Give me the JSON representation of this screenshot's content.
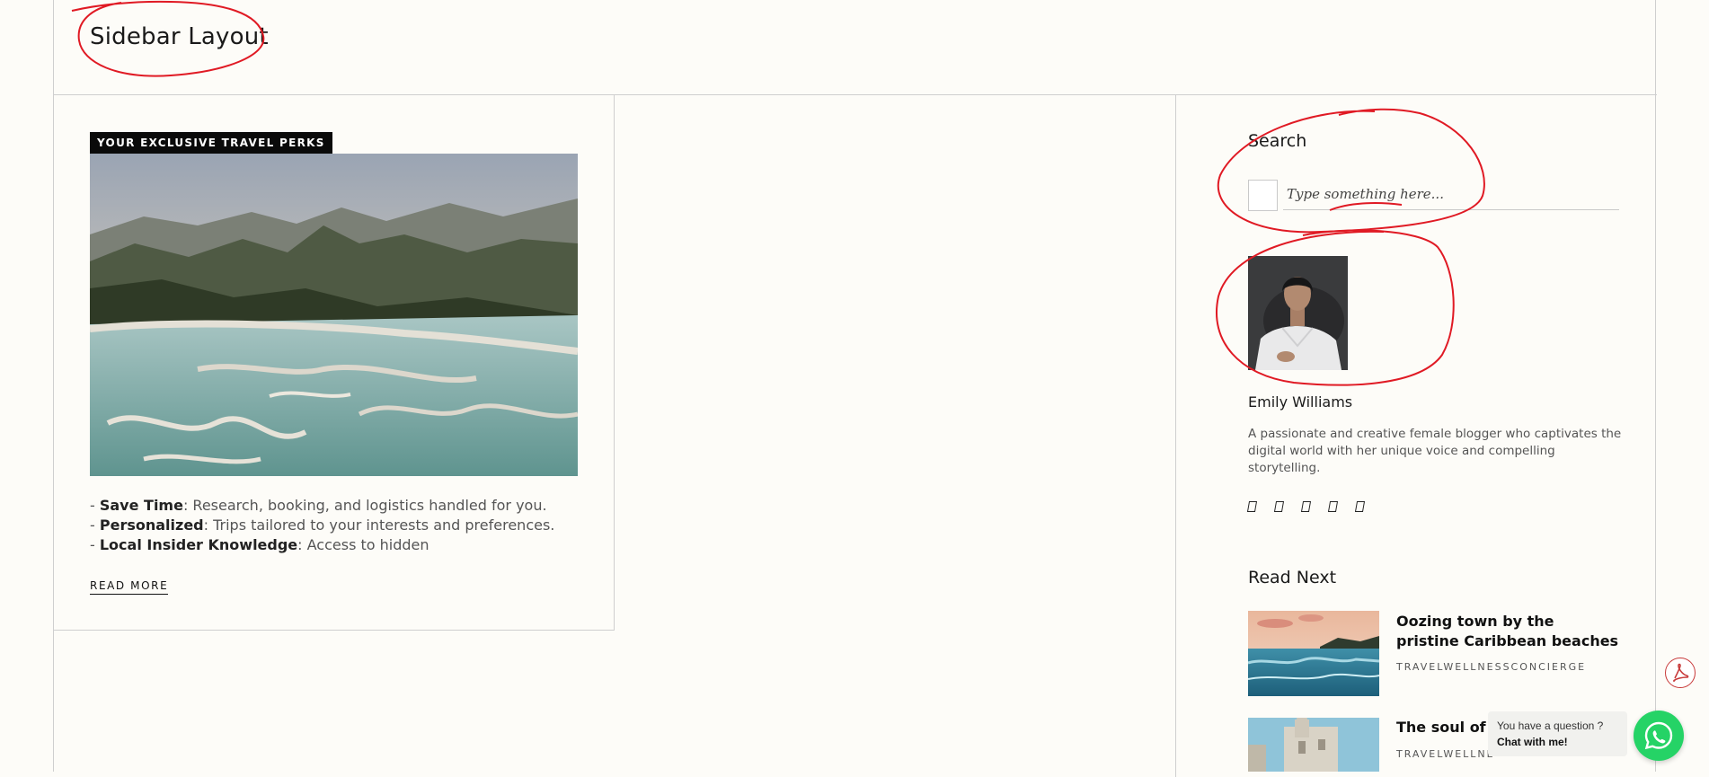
{
  "page": {
    "title": "Sidebar Layout"
  },
  "post": {
    "tag": "YOUR EXCLUSIVE TRAVEL PERKS",
    "image_alt": "Mountain landscape with turquoise mineral pools",
    "excerpt": [
      {
        "bold": "Save Time",
        "text": ": Research, booking, and logistics handled for you."
      },
      {
        "bold": "Personalized",
        "text": ": Trips tailored to your interests and preferences."
      },
      {
        "bold": "Local Insider Knowledge",
        "text": ": Access to hidden"
      }
    ],
    "read_more": "READ MORE"
  },
  "sidebar": {
    "search": {
      "title": "Search",
      "placeholder": "Type something here..."
    },
    "author": {
      "name": "Emily Williams",
      "bio": "A passionate and creative female blogger who captivates the digital world with her unique voice and compelling storytelling.",
      "social_icons": [
        "social-icon-1",
        "social-icon-2",
        "social-icon-3",
        "social-icon-4",
        "social-icon-5"
      ]
    },
    "read_next": {
      "title": "Read Next",
      "items": [
        {
          "title": "Oozing town by the pristine Caribbean beaches",
          "category": "TRAVELWELLNESSCONCIERGE"
        },
        {
          "title": "The soul of M",
          "category": "TRAVELWELLNE"
        }
      ]
    }
  },
  "chat": {
    "question": "You have a question ?",
    "cta": "Chat with me!"
  },
  "colors": {
    "background": "#fdfcf8",
    "tag_bg": "#0a0a0a",
    "whatsapp": "#25d366",
    "annotation": "#e01a24"
  }
}
